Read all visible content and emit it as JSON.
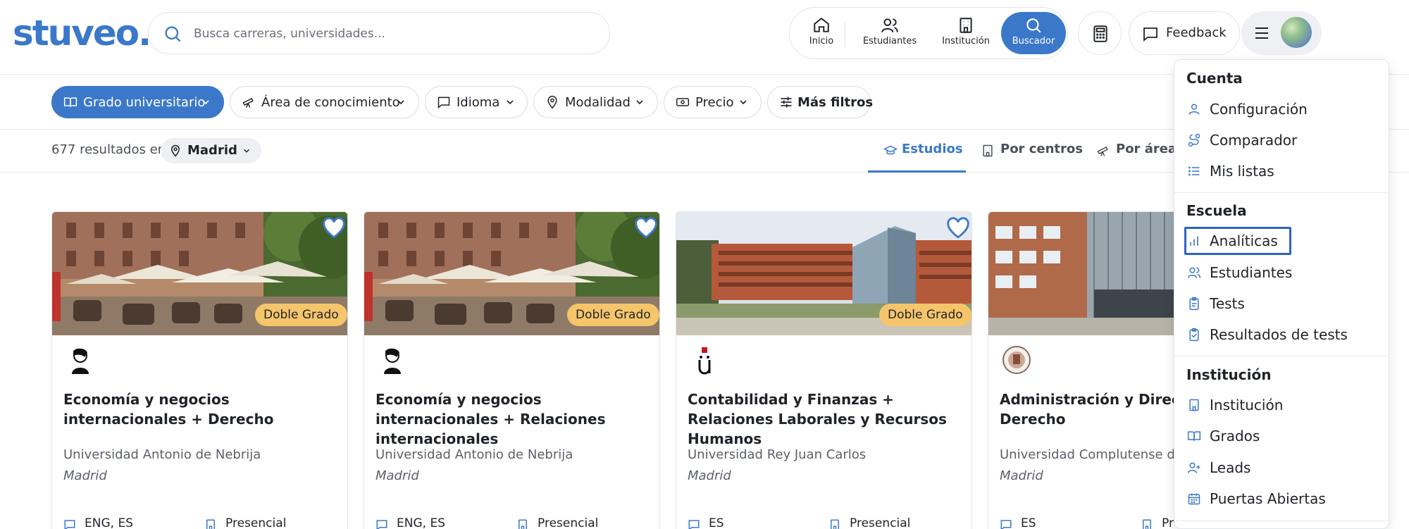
{
  "header": {
    "logo": "stuveo.",
    "search_placeholder": "Busca carreras, universidades...",
    "nav": [
      {
        "label": "Inicio",
        "icon": "home-icon"
      },
      {
        "label": "Estudiantes",
        "icon": "users-icon"
      },
      {
        "label": "Institución",
        "icon": "building-icon"
      },
      {
        "label": "Buscador",
        "icon": "search-icon",
        "active": true
      }
    ],
    "feedback_label": "Feedback"
  },
  "filters": [
    {
      "label": "Grado universitario",
      "icon": "book-open-icon",
      "primary": true
    },
    {
      "label": "Área de conocimiento",
      "icon": "telescope-icon"
    },
    {
      "label": "Idioma",
      "icon": "message-square-icon"
    },
    {
      "label": "Modalidad",
      "icon": "map-pin-icon"
    },
    {
      "label": "Precio",
      "icon": "banknote-icon"
    },
    {
      "label": "Más filtros",
      "icon": "sliders-icon"
    }
  ],
  "results": {
    "count_text": "677 resultados en",
    "location": "Madrid",
    "tabs": [
      {
        "label": "Estudios",
        "icon": "graduation-cap-icon",
        "active": true
      },
      {
        "label": "Por centros",
        "icon": "building-icon"
      },
      {
        "label": "Por áreas",
        "icon": "telescope-icon"
      }
    ]
  },
  "cards": [
    {
      "title": "Economía y negocios internacionales + Derecho",
      "university": "Universidad Antonio de Nebrija",
      "city": "Madrid",
      "badge": "Doble Grado",
      "languages": "ENG, ES",
      "modality": "Presencial"
    },
    {
      "title": "Economía y negocios internacionales + Relaciones internacionales",
      "university": "Universidad Antonio de Nebrija",
      "city": "Madrid",
      "badge": "Doble Grado",
      "languages": "ENG, ES",
      "modality": "Presencial"
    },
    {
      "title": "Contabilidad y Finanzas + Relaciones Laborales y Recursos Humanos",
      "university": "Universidad Rey Juan Carlos",
      "city": "Madrid",
      "badge": "Doble Grado",
      "languages": "ES",
      "modality": "Presencial"
    },
    {
      "title": "Administración y Dirección + Derecho",
      "university": "Universidad Complutense de M",
      "city": "Madrid",
      "badge": "",
      "languages": "ES",
      "modality": "Pre"
    }
  ],
  "menu": {
    "sections": [
      {
        "title": "Cuenta",
        "items": [
          {
            "label": "Configuración",
            "icon": "user-icon"
          },
          {
            "label": "Comparador",
            "icon": "route-icon"
          },
          {
            "label": "Mis listas",
            "icon": "list-icon"
          }
        ]
      },
      {
        "title": "Escuela",
        "items": [
          {
            "label": "Analíticas",
            "icon": "bar-chart-icon",
            "selected": true
          },
          {
            "label": "Estudiantes",
            "icon": "users-icon"
          },
          {
            "label": "Tests",
            "icon": "clipboard-icon"
          },
          {
            "label": "Resultados de tests",
            "icon": "clipboard-check-icon"
          }
        ]
      },
      {
        "title": "Institución",
        "items": [
          {
            "label": "Institución",
            "icon": "building-icon"
          },
          {
            "label": "Grados",
            "icon": "book-open-icon"
          },
          {
            "label": "Leads",
            "icon": "user-plus-icon"
          },
          {
            "label": "Puertas Abiertas",
            "icon": "calendar-icon"
          }
        ]
      }
    ]
  },
  "colors": {
    "brand": "#3b78c9",
    "badge": "#f5c56b",
    "text": "#1f2328"
  }
}
